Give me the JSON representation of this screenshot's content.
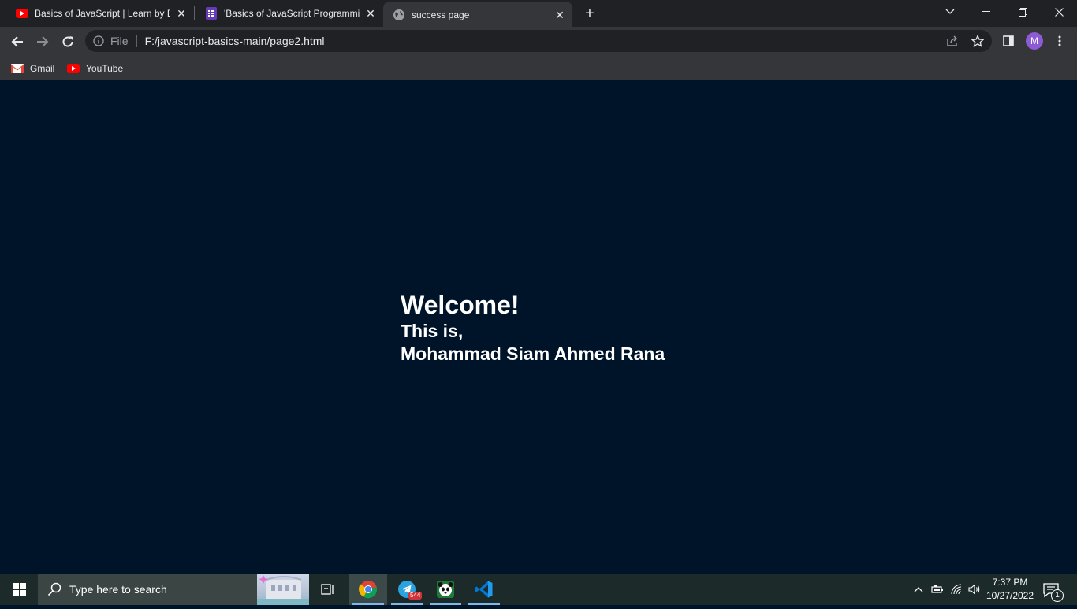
{
  "browser": {
    "tabs": [
      {
        "label": "Basics of JavaScript | Learn by Do",
        "favicon": "youtube-icon"
      },
      {
        "label": "'Basics of JavaScript Programmin",
        "favicon": "forms-icon"
      },
      {
        "label": "success page",
        "favicon": "globe-icon",
        "active": true
      }
    ],
    "address": {
      "scheme": "File",
      "url": "F:/javascript-basics-main/page2.html"
    },
    "profile_initial": "M",
    "bookmarks": [
      {
        "label": "Gmail",
        "icon": "gmail-icon"
      },
      {
        "label": "YouTube",
        "icon": "youtube-icon"
      }
    ]
  },
  "page": {
    "heading": "Welcome!",
    "line1": "This is,",
    "line2": "Mohammad Siam Ahmed Rana",
    "background_color": "#001429",
    "text_color": "#ffffff"
  },
  "taskbar": {
    "search_placeholder": "Type here to search",
    "apps": [
      "task-view",
      "chrome",
      "telegram",
      "app-panda",
      "vscode"
    ],
    "telegram_badge": "544",
    "time": "7:37 PM",
    "date": "10/27/2022",
    "notification_count": "1"
  }
}
